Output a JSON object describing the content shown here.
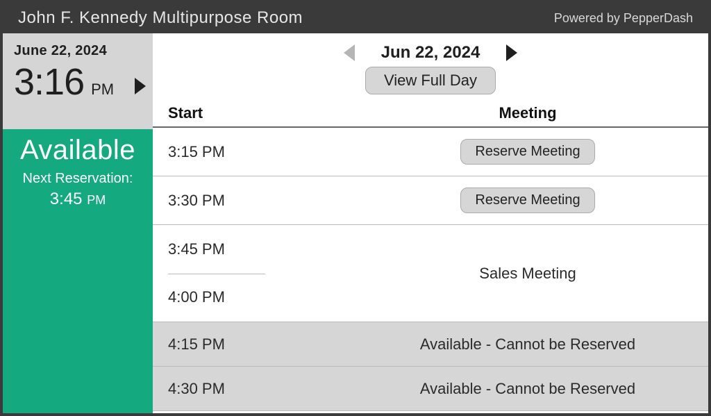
{
  "header": {
    "room_name": "John F. Kennedy Multipurpose Room",
    "powered_by": "Powered by PepperDash"
  },
  "clock": {
    "date": "June 22, 2024",
    "time": "3:16",
    "ampm": "PM"
  },
  "status": {
    "label": "Available",
    "next_label": "Next Reservation:",
    "next_time": "3:45",
    "next_ampm": "PM"
  },
  "schedule": {
    "date": "Jun 22, 2024",
    "view_full_day": "View Full Day",
    "headers": {
      "start": "Start",
      "meeting": "Meeting"
    },
    "reserve_label": "Reserve Meeting",
    "rows": {
      "r0_time": "3:15 PM",
      "r1_time": "3:30 PM",
      "r2a_time": "3:45 PM",
      "r2b_time": "4:00 PM",
      "r2_meeting": "Sales Meeting",
      "r3_time": "4:15 PM",
      "r3_text": "Available - Cannot be Reserved",
      "r4_time": "4:30 PM",
      "r4_text": "Available - Cannot be Reserved"
    }
  }
}
